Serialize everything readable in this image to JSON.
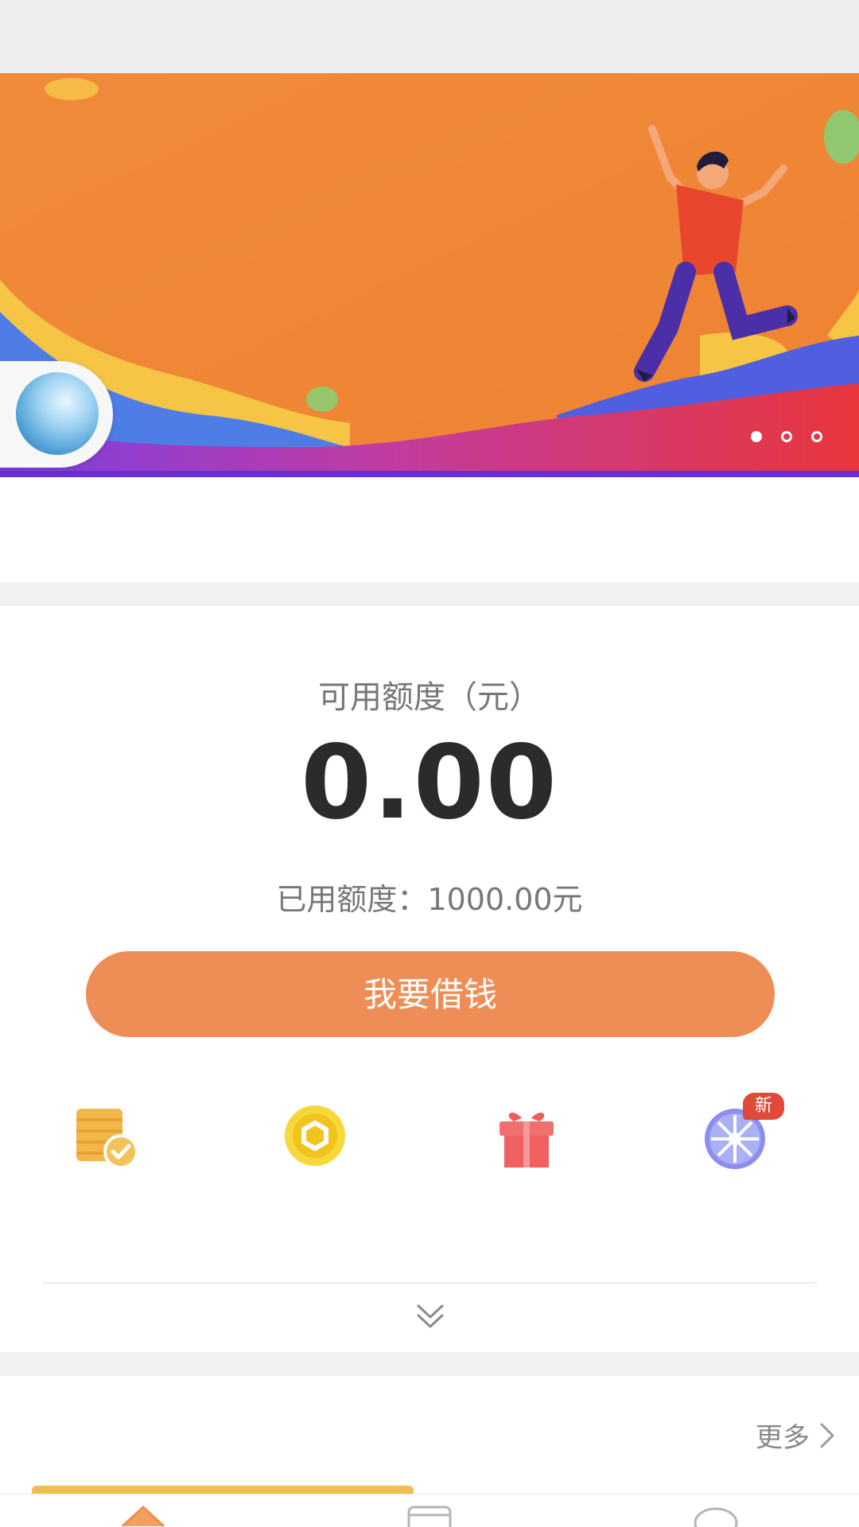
{
  "banner": {
    "active_slide": 1,
    "slide_count": 3
  },
  "credit": {
    "label": "可用额度（元）",
    "value": "0.00",
    "used_text": "已用额度：1000.00元",
    "borrow_button": "我要借钱"
  },
  "quick_actions": [
    {
      "icon": "coins-check-icon"
    },
    {
      "icon": "gold-coin-icon"
    },
    {
      "icon": "gift-icon"
    },
    {
      "icon": "lucky-wheel-icon",
      "badge": "新"
    }
  ],
  "section": {
    "more_label": "更多"
  },
  "tabbar": {
    "items": [
      {
        "icon": "home-icon",
        "active": true
      },
      {
        "icon": "card-icon"
      },
      {
        "icon": "chat-icon"
      }
    ]
  },
  "colors": {
    "accent": "#ee8e56",
    "banner_orange": "#ef8a3c",
    "badge_red": "#e04a3a"
  }
}
